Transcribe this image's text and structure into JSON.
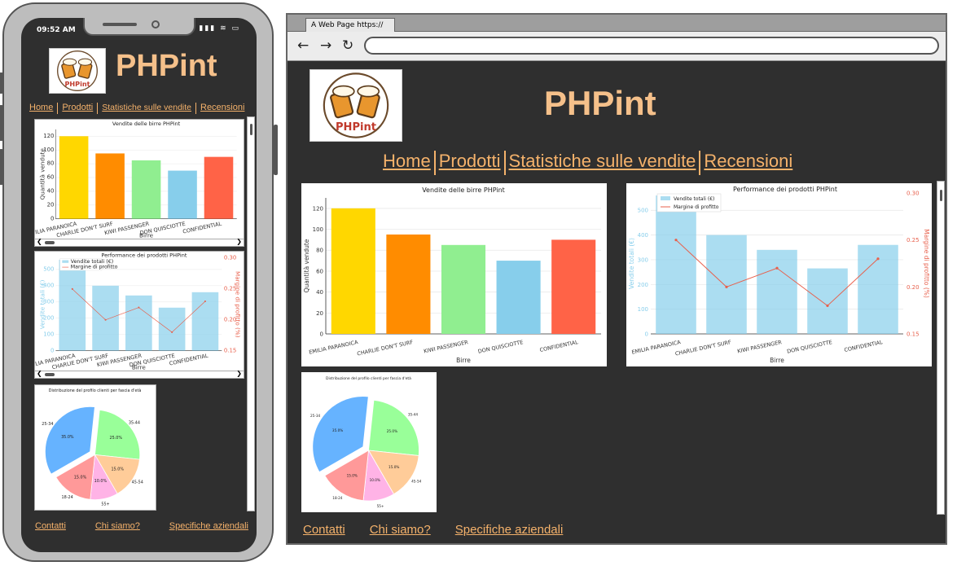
{
  "phone": {
    "status_time": "09:52 AM",
    "status_icons": "▮▮▮ ≋ ▭"
  },
  "site": {
    "title": "PHPint",
    "logo_text": "PHPint",
    "nav": [
      "Home",
      "Prodotti",
      "Statistiche sulle vendite",
      "Recensioni"
    ],
    "footer": [
      "Contatti",
      "Chi siamo?",
      "Specifiche aziendali"
    ]
  },
  "browser": {
    "tab_title": "A Web Page https://",
    "url_value": ""
  },
  "colors": {
    "background": "#2f2f2f",
    "accent": "#f5b26b",
    "title": "#f5c08a"
  },
  "chart_data": [
    {
      "type": "bar",
      "title": "Vendite delle birre PHPint",
      "xlabel": "Birre",
      "ylabel": "Quantità vendute",
      "categories": [
        "EMILIA PARANOICA",
        "CHARLIE DON'T SURF",
        "KIWI PASSENGER",
        "DON QUISCIOTTE",
        "CONFIDENTIAL"
      ],
      "values": [
        120,
        95,
        85,
        70,
        90
      ],
      "colors": [
        "#ffd700",
        "#ff8c00",
        "#90ee90",
        "#87ceeb",
        "#ff6347"
      ],
      "ylim": [
        0,
        130
      ],
      "yticks": [
        0,
        20,
        40,
        60,
        80,
        100,
        120
      ]
    },
    {
      "type": "bar+line",
      "title": "Performance dei prodotti PHPint",
      "xlabel": "Birre",
      "ylabel": "Vendite totali (€)",
      "ylabel_right": "Margine di profitto (%)",
      "categories": [
        "EMILIA PARANOICA",
        "CHARLIE DON'T SURF",
        "KIWI PASSENGER",
        "DON QUISCIOTTE",
        "CONFIDENTIAL"
      ],
      "series": [
        {
          "name": "Vendite totali (€)",
          "kind": "bar",
          "axis": "left",
          "color": "#87ceeb",
          "values": [
            560,
            400,
            340,
            265,
            360
          ]
        },
        {
          "name": "Margine di profitto",
          "kind": "line",
          "axis": "right",
          "color": "#e8604c",
          "values": [
            0.25,
            0.2,
            0.22,
            0.18,
            0.23
          ]
        }
      ],
      "ylim": [
        0,
        570
      ],
      "yticks": [
        0,
        100,
        200,
        300,
        400,
        500
      ],
      "ylim_right": [
        0.15,
        0.3
      ],
      "yticks_right": [
        "0.15",
        "0.20",
        "0.25",
        "0.30"
      ],
      "legend": "top-left"
    },
    {
      "type": "pie",
      "title": "Distribuzione del profilo clienti per fascia d'età",
      "labels": [
        "25-34",
        "35-44",
        "45-54",
        "55+",
        "18-24"
      ],
      "values": [
        35.0,
        25.0,
        15.0,
        10.0,
        15.0
      ],
      "pct_labels": [
        "35.0%",
        "25.0%",
        "15.0%",
        "10.0%",
        "15.0%"
      ],
      "colors": [
        "#66b3ff",
        "#99ff99",
        "#ffcc99",
        "#ffb3e6",
        "#ff9999"
      ],
      "explode": "25-34"
    }
  ]
}
